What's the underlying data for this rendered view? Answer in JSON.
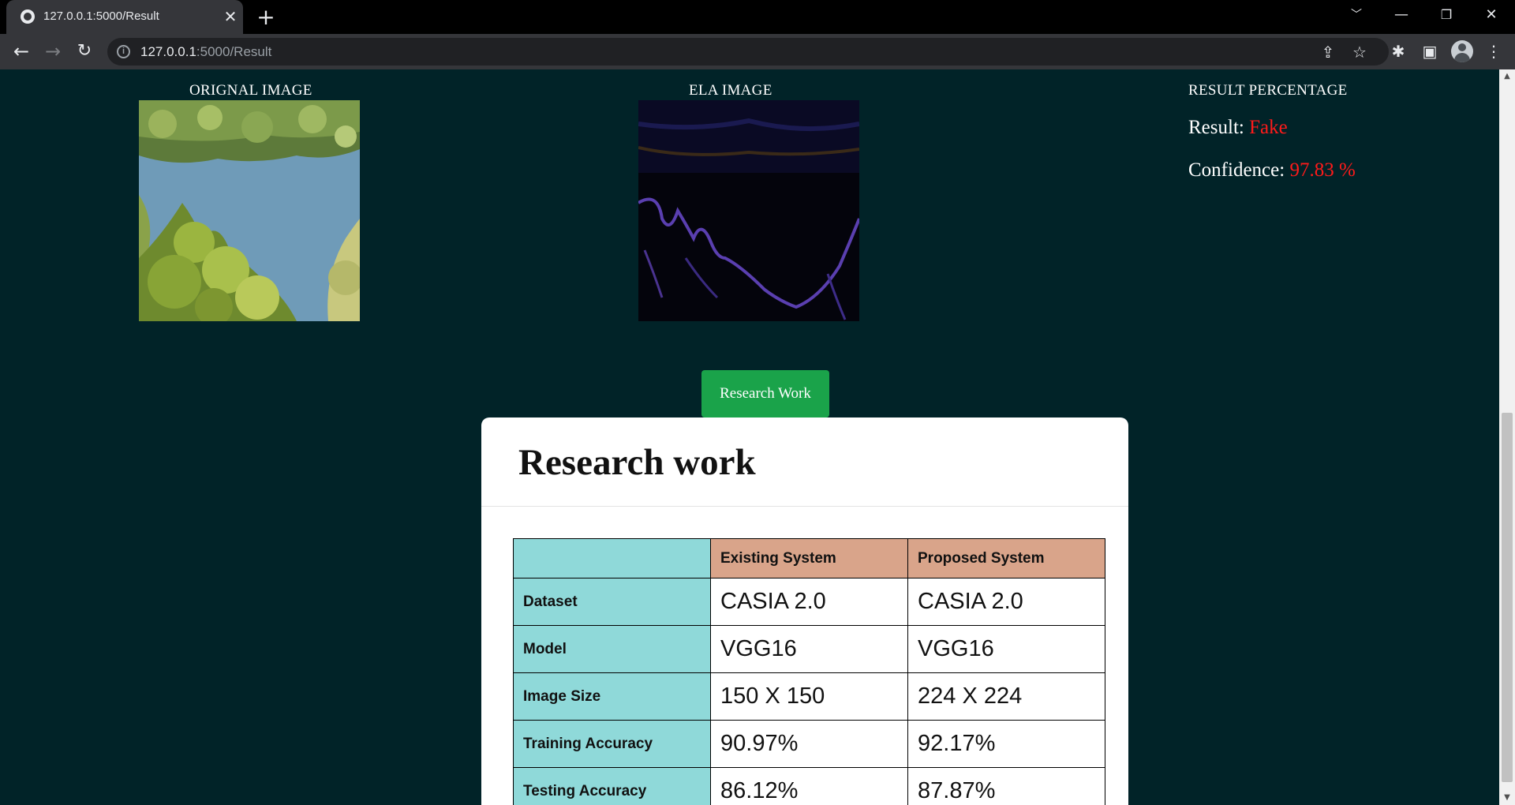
{
  "browser": {
    "tab_title": "127.0.0.1:5000/Result",
    "url_host": "127.0.0.1",
    "url_path": ":5000/Result"
  },
  "page": {
    "original_title": "ORIGNAL IMAGE",
    "ela_title": "ELA IMAGE",
    "result_title": "RESULT PERCENTAGE",
    "result_label": "Result: ",
    "result_value": "Fake",
    "confidence_label": "Confidence: ",
    "confidence_value": "97.83 %",
    "research_button": "Research Work"
  },
  "research": {
    "title": "Research work",
    "columns": [
      "",
      "Existing System",
      "Proposed System"
    ],
    "rows": [
      {
        "label": "Dataset",
        "existing": "CASIA 2.0",
        "proposed": "CASIA 2.0"
      },
      {
        "label": "Model",
        "existing": "VGG16",
        "proposed": "VGG16"
      },
      {
        "label": "Image Size",
        "existing": "150 X 150",
        "proposed": "224 X 224"
      },
      {
        "label": "Training Accuracy",
        "existing": "90.97%",
        "proposed": "92.17%"
      },
      {
        "label": "Testing Accuracy",
        "existing": "86.12%",
        "proposed": "87.87%"
      }
    ]
  },
  "colors": {
    "page_background": "#012328",
    "result_red": "#ff1a1a",
    "button_green": "#1aa34a",
    "table_label_cyan": "#8fd9d9",
    "table_header_salmon": "#d9a48a"
  }
}
